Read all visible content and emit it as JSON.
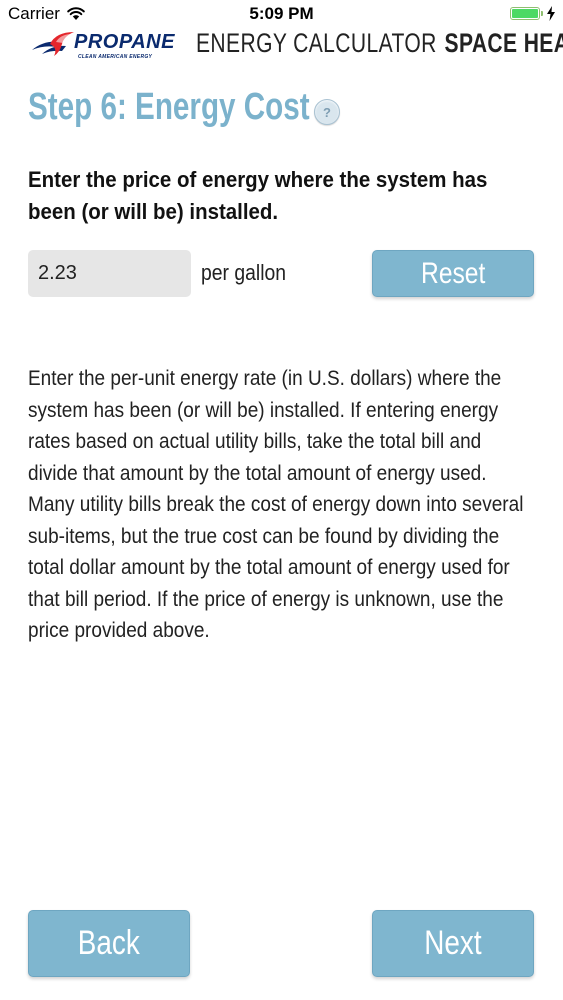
{
  "status_bar": {
    "carrier": "Carrier",
    "time": "5:09 PM",
    "battery_level": 1.0
  },
  "header": {
    "logo_word": "PROPANE",
    "logo_tagline": "CLEAN AMERICAN ENERGY",
    "title_light": "ENERGY CALCULATOR",
    "title_bold": "SPACE HEATERS"
  },
  "step": {
    "heading": "Step 6: Energy Cost",
    "help_label": "?"
  },
  "form": {
    "instruction": "Enter the price of energy where the system has been (or will be) installed.",
    "price_value": "2.23",
    "unit_label": "per gallon",
    "reset_label": "Reset"
  },
  "description": "Enter the per-unit energy rate (in U.S. dollars) where the system has been (or will be) installed. If entering energy rates based on actual utility bills, take the total bill and divide that amount by the total amount of energy used. Many utility bills break the cost of energy down into several sub-items, but the true cost can be found by dividing the total dollar amount by the total amount of energy used for that bill period. If the price of energy is unknown, use the price provided above.",
  "nav": {
    "back_label": "Back",
    "next_label": "Next"
  },
  "colors": {
    "accent": "#7fb6cf",
    "heading": "#7bb2cc",
    "logo_navy": "#0a2a6e",
    "logo_red": "#e4262c",
    "battery_green": "#4cd964",
    "input_bg": "#e6e6e6"
  }
}
